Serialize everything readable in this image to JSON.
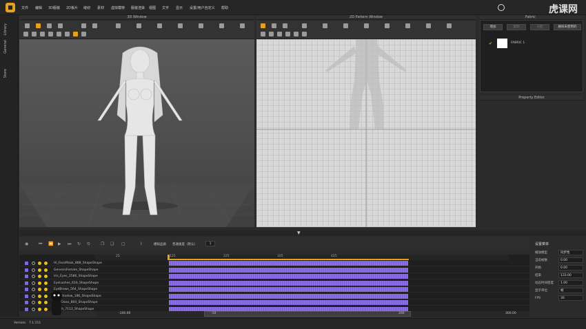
{
  "menu": [
    "文件",
    "编辑",
    "3D服装",
    "2D板片",
    "缝纫",
    "素材",
    "虚拟模特",
    "服装渲染",
    "视图",
    "文字",
    "显示",
    "设置/用户自定义",
    "帮助"
  ],
  "watermark": "虎课网",
  "side_tabs": [
    "Library",
    "General",
    "Store"
  ],
  "panels": {
    "view3d_title": "3D Window",
    "pattern_title": "2D Pattern Window",
    "object_browser_title": "Fabric",
    "property_editor_title": "Property Editor"
  },
  "object_browser": {
    "buttons": [
      "增加",
      "复制",
      "分配",
      "删除未使用的"
    ],
    "fabric_item": "FABRIC 1"
  },
  "timeline": {
    "mode_label": "模拟品质",
    "speed_label": "普通速度（默认）",
    "speed_value": "1",
    "ruler_ticks": [
      "25",
      "50",
      "75",
      "100",
      "125",
      "150",
      "175",
      "200",
      "225",
      "250",
      "275",
      "300",
      "325",
      "350",
      "375",
      "400",
      "425",
      "450",
      "475",
      "500"
    ],
    "tracks": [
      "Hi_FaceMask_888_ShapeShape",
      "GenesisFemale_ShapeShape",
      "Iris_Eyes_2586_ShapeShape",
      "EyeLashes_616_ShapeShape",
      "EyeBrows_564_ShapeShape",
      "FootShadow_186_ShapeShape",
      "FaceGloss_804_ShapeShape",
      "Mouth_7112_ShapeShape"
    ],
    "range_start": "-100.00",
    "range_mid_left": "-10",
    "range_mid_right": "200",
    "range_end": "300.00"
  },
  "timeline_props": {
    "title": "设置菜单",
    "rows": [
      {
        "label": "播放模型",
        "value": "同步性"
      },
      {
        "label": "当前帧数",
        "value": "0.00"
      },
      {
        "label": "开始",
        "value": "0.00"
      },
      {
        "label": "结束",
        "value": "133.00"
      },
      {
        "label": "动态时间密度",
        "value": "1.00"
      },
      {
        "label": "显示单位",
        "value": "帧"
      },
      {
        "label": "FPS",
        "value": "30"
      }
    ]
  },
  "status": {
    "version_label": "Version:",
    "version_value": "7.1.111"
  },
  "colors": {
    "accent": "#e8a020",
    "track_bar": "#8c6ee6",
    "pattern_bg": "#d9d9d9"
  }
}
